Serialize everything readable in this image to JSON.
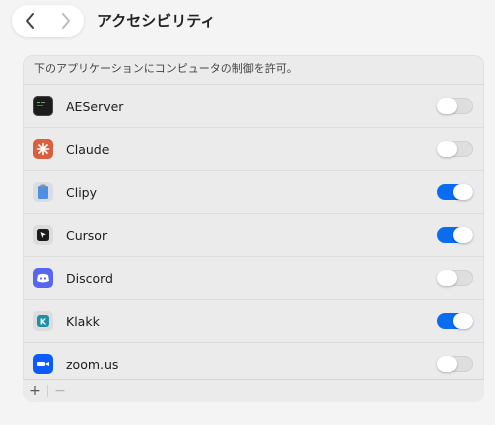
{
  "window": {
    "title": "アクセシビリティ"
  },
  "nav": {
    "back_icon": "chevron-left-icon",
    "forward_icon": "chevron-right-icon"
  },
  "panel": {
    "description": "下のアプリケーションにコンピュータの制御を許可。",
    "apps": [
      {
        "name": "AEServer",
        "icon": "terminal-icon",
        "enabled": false
      },
      {
        "name": "Claude",
        "icon": "claude-icon",
        "enabled": false
      },
      {
        "name": "Clipy",
        "icon": "clipboard-icon",
        "enabled": true
      },
      {
        "name": "Cursor",
        "icon": "cursor-icon",
        "enabled": true
      },
      {
        "name": "Discord",
        "icon": "discord-icon",
        "enabled": false
      },
      {
        "name": "Klakk",
        "icon": "klakk-icon",
        "enabled": true
      },
      {
        "name": "zoom.us",
        "icon": "zoom-icon",
        "enabled": false
      }
    ]
  },
  "footer": {
    "add_label": "+",
    "remove_label": "−"
  },
  "colors": {
    "toggle_on": "#0a6cf0",
    "toggle_off": "#dedede"
  }
}
